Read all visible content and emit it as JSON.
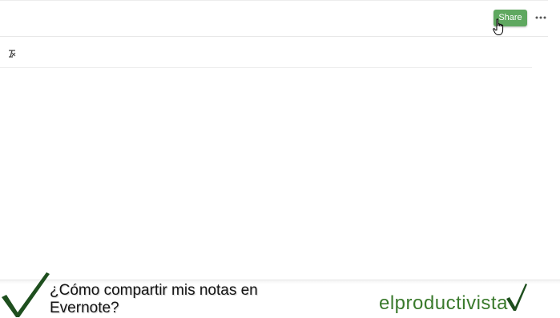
{
  "toolbar": {
    "share_label": "Share",
    "more_label": "···"
  },
  "format_row": {
    "clear_format_icon": "clear-formatting-icon"
  },
  "caption": {
    "question": "¿Cómo compartir mis notas en Evernote?"
  },
  "brand": {
    "name": "elproductivista"
  },
  "colors": {
    "share_button": "#5fa860",
    "brand_green": "#3a7a2c",
    "check_dark_green": "#1e4f1e"
  }
}
